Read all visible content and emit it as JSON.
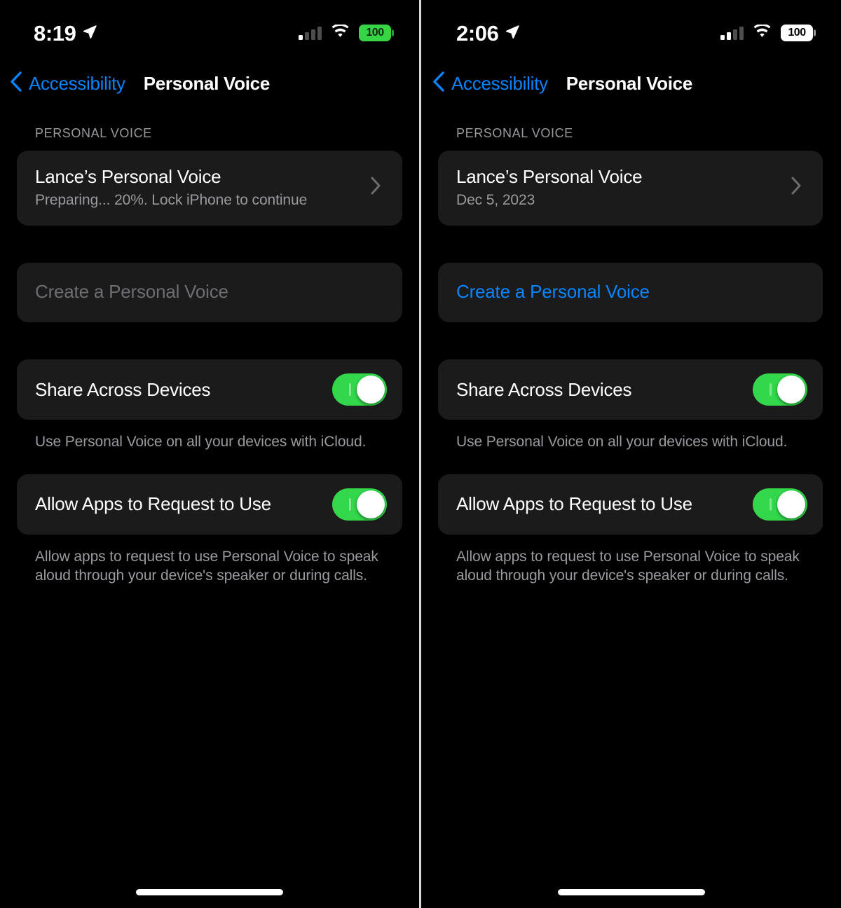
{
  "panels": [
    {
      "status": {
        "time": "8:19",
        "location_icon": "location-arrow-icon",
        "signal_icon": "cellular-signal-icon",
        "signal_bars_active": 1,
        "wifi_icon": "wifi-icon",
        "battery_percent": "100",
        "battery_style": "green"
      },
      "nav": {
        "back_icon": "chevron-left-icon",
        "back_label": "Accessibility",
        "title": "Personal Voice"
      },
      "section_header": "PERSONAL VOICE",
      "voice_row": {
        "title": "Lance’s Personal Voice",
        "subtitle": "Preparing... 20%. Lock iPhone to continue",
        "chevron_icon": "chevron-right-icon"
      },
      "create_row": {
        "label": "Create a Personal Voice",
        "state": "disabled",
        "color": "#6d6d72"
      },
      "share_row": {
        "label": "Share Across Devices",
        "toggle_state": "on",
        "toggle_color": "#32d74b"
      },
      "share_footnote": "Use Personal Voice on all your devices with iCloud.",
      "allow_row": {
        "label": "Allow Apps to Request to Use",
        "toggle_state": "on",
        "toggle_color": "#32d74b"
      },
      "allow_footnote": "Allow apps to request to use Personal Voice to speak aloud through your device's speaker or during calls."
    },
    {
      "status": {
        "time": "2:06",
        "location_icon": "location-arrow-icon",
        "signal_icon": "cellular-signal-icon",
        "signal_bars_active": 2,
        "wifi_icon": "wifi-icon",
        "battery_percent": "100",
        "battery_style": "white"
      },
      "nav": {
        "back_icon": "chevron-left-icon",
        "back_label": "Accessibility",
        "title": "Personal Voice"
      },
      "section_header": "PERSONAL VOICE",
      "voice_row": {
        "title": "Lance’s Personal Voice",
        "subtitle": "Dec 5, 2023",
        "chevron_icon": "chevron-right-icon"
      },
      "create_row": {
        "label": "Create a Personal Voice",
        "state": "enabled",
        "color": "#0a84ff"
      },
      "share_row": {
        "label": "Share Across Devices",
        "toggle_state": "on",
        "toggle_color": "#32d74b"
      },
      "share_footnote": "Use Personal Voice on all your devices with iCloud.",
      "allow_row": {
        "label": "Allow Apps to Request to Use",
        "toggle_state": "on",
        "toggle_color": "#32d74b"
      },
      "allow_footnote": "Allow apps to request to use Personal Voice to speak aloud through your device's speaker or during calls."
    }
  ]
}
